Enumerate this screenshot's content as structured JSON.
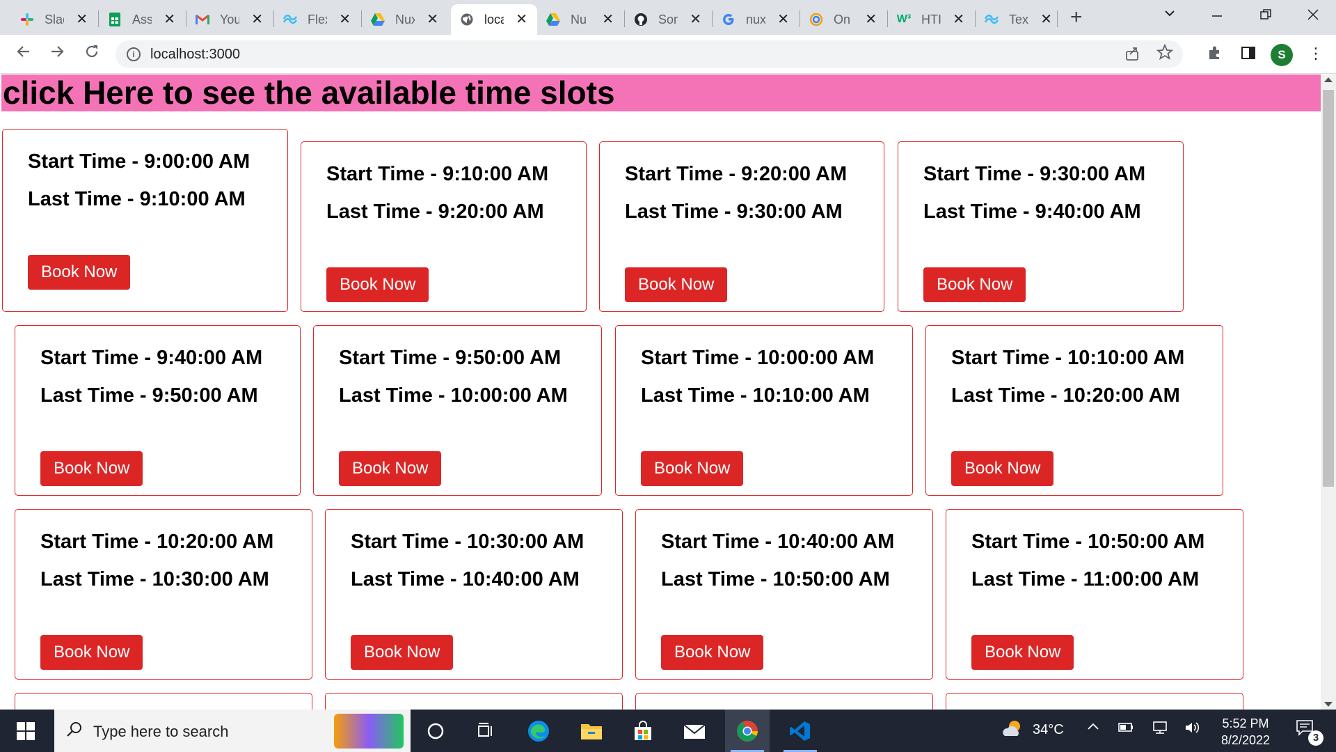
{
  "browser": {
    "tabs": [
      {
        "title": "Slac",
        "icon": "slack-icon",
        "active": false
      },
      {
        "title": "Assi",
        "icon": "google-sheets-icon",
        "active": false
      },
      {
        "title": "You",
        "icon": "gmail-icon",
        "active": false
      },
      {
        "title": "Flex",
        "icon": "tailwind-icon",
        "active": false
      },
      {
        "title": "Nux",
        "icon": "google-drive-icon",
        "active": false
      },
      {
        "title": "loca",
        "icon": "globe-icon",
        "active": true
      },
      {
        "title": "Nu",
        "icon": "google-drive-icon",
        "active": false
      },
      {
        "title": "Son",
        "icon": "github-icon",
        "active": false
      },
      {
        "title": "nux",
        "icon": "google-icon",
        "active": false
      },
      {
        "title": "On",
        "icon": "spiral-icon",
        "active": false
      },
      {
        "title": "HTI",
        "icon": "w3schools-icon",
        "active": false
      },
      {
        "title": "Text",
        "icon": "tailwind-icon",
        "active": false
      }
    ],
    "close_glyph": "✕",
    "new_tab_glyph": "+",
    "url": "localhost:3000",
    "profile_initial": "S"
  },
  "page": {
    "headline": "click Here to see the available time slots",
    "start_prefix": "Start Time - ",
    "last_prefix": "Last Time - ",
    "book_label": "Book Now",
    "slots": [
      {
        "start": "9:00:00 AM",
        "last": "9:10:00 AM"
      },
      {
        "start": "9:10:00 AM",
        "last": "9:20:00 AM"
      },
      {
        "start": "9:20:00 AM",
        "last": "9:30:00 AM"
      },
      {
        "start": "9:30:00 AM",
        "last": "9:40:00 AM"
      },
      {
        "start": "9:40:00 AM",
        "last": "9:50:00 AM"
      },
      {
        "start": "9:50:00 AM",
        "last": "10:00:00 AM"
      },
      {
        "start": "10:00:00 AM",
        "last": "10:10:00 AM"
      },
      {
        "start": "10:10:00 AM",
        "last": "10:20:00 AM"
      },
      {
        "start": "10:20:00 AM",
        "last": "10:30:00 AM"
      },
      {
        "start": "10:30:00 AM",
        "last": "10:40:00 AM"
      },
      {
        "start": "10:40:00 AM",
        "last": "10:50:00 AM"
      },
      {
        "start": "10:50:00 AM",
        "last": "11:00:00 AM"
      }
    ],
    "colors": {
      "headline_bg": "#f472b6",
      "accent": "#dc2626"
    }
  },
  "taskbar": {
    "search_placeholder": "Type here to search",
    "apps": [
      "cortana-icon",
      "task-view-icon",
      "edge-icon",
      "file-explorer-icon",
      "microsoft-store-icon",
      "mail-icon",
      "chrome-icon",
      "vscode-icon"
    ],
    "weather": "34°C",
    "time": "5:52 PM",
    "date": "8/2/2022",
    "notification_count": "3"
  }
}
